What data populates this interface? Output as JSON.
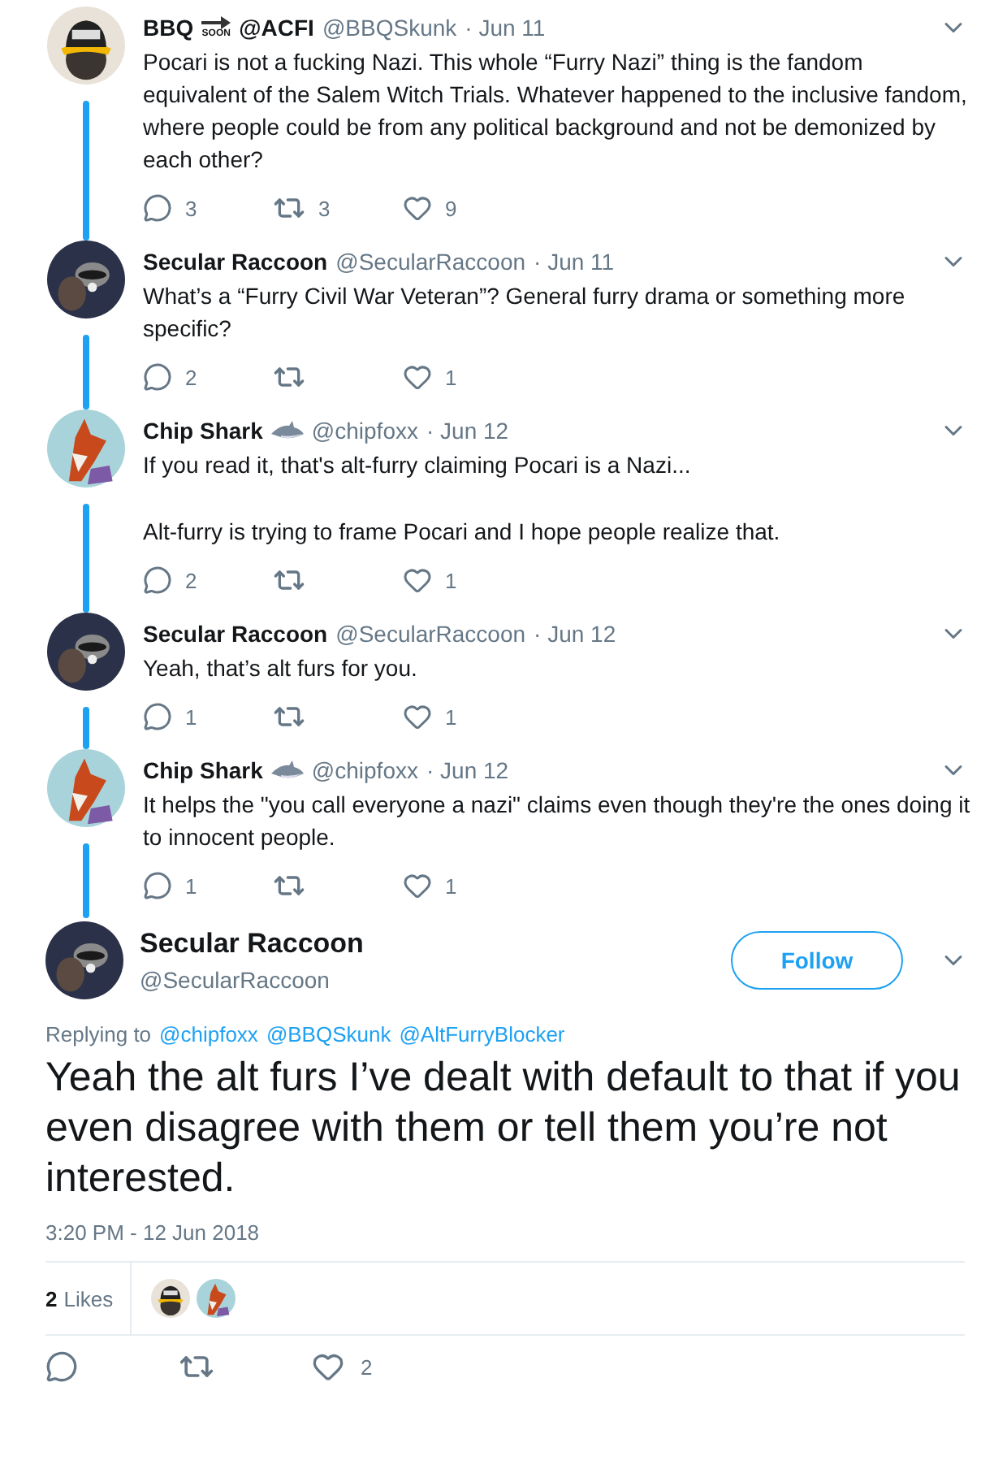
{
  "thread": [
    {
      "avatar": {
        "kind": "picture"
      },
      "name": "BBQ",
      "name_badge": {
        "kind": "soon",
        "text": "SOON"
      },
      "name_after": "@ACFI",
      "handle": "@BBQSkunk",
      "date": "· Jun 11",
      "paragraphs": [
        "Pocari is not a fucking Nazi. This whole “Furry Nazi” thing is the fandom equivalent of the Salem Witch Trials. Whatever happened to the inclusive fandom, where people could be from any political background and not be demonized by each other?"
      ],
      "replies": "3",
      "retweets": "3",
      "likes": "9"
    },
    {
      "avatar": {
        "kind": "picture"
      },
      "name": "Secular Raccoon",
      "handle": "@SecularRaccoon",
      "date": "· Jun 11",
      "paragraphs": [
        "What’s a “Furry Civil War Veteran”?  General furry drama or something more specific?"
      ],
      "replies": "2",
      "likes": "1"
    },
    {
      "avatar": {
        "kind": "picture"
      },
      "name": "Chip Shark",
      "name_badge": {
        "kind": "shark"
      },
      "handle": "@chipfoxx",
      "date": "· Jun 12",
      "paragraphs": [
        "If you read it, that's alt-furry claiming Pocari is a Nazi...",
        "Alt-furry is trying to frame Pocari and I hope people realize that."
      ],
      "replies": "2",
      "likes": "1"
    },
    {
      "avatar": {
        "kind": "picture"
      },
      "name": "Secular Raccoon",
      "handle": "@SecularRaccoon",
      "date": "· Jun 12",
      "paragraphs": [
        "Yeah, that’s alt furs for you."
      ],
      "replies": "1",
      "likes": "1"
    },
    {
      "avatar": {
        "kind": "picture"
      },
      "name": "Chip Shark",
      "name_badge": {
        "kind": "shark"
      },
      "handle": "@chipfoxx",
      "date": "· Jun 12",
      "paragraphs": [
        "It helps the \"you call everyone a nazi\" claims even though they're the ones doing it to innocent people."
      ],
      "replies": "1",
      "likes": "1"
    }
  ],
  "main": {
    "avatar": {
      "kind": "picture"
    },
    "name": "Secular Raccoon",
    "handle": "@SecularRaccoon",
    "follow": "Follow",
    "replying_label": "Replying to",
    "mentions": [
      "@chipfoxx",
      "@BBQSkunk",
      "@AltFurryBlocker"
    ],
    "text": "Yeah the alt furs I’ve dealt with default to that if you even disagree with them or tell them you’re not interested.",
    "timestamp": "3:20 PM - 12 Jun 2018",
    "likes_count": "2",
    "likes_label": "Likes",
    "likers": [
      {
        "kind": "picture"
      },
      {
        "kind": "picture"
      }
    ],
    "like_total": "2"
  }
}
